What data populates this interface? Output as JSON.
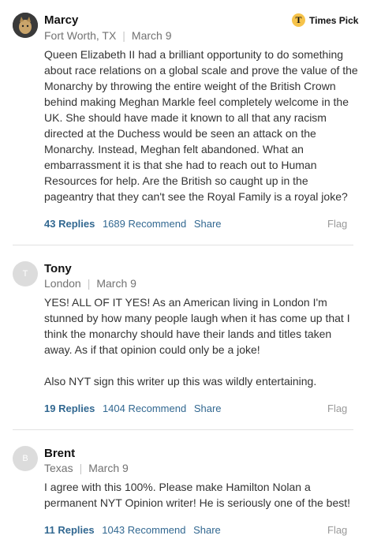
{
  "comments": [
    {
      "name": "Marcy",
      "location": "Fort Worth, TX",
      "date": "March 9",
      "times_pick": "Times Pick",
      "times_pick_badge": "T",
      "body": "Queen Elizabeth II had a brilliant opportunity to do something about race relations on a global scale and prove the value of the Monarchy by throwing the entire weight of the British Crown behind making Meghan Markle feel completely welcome in the UK.  She should have made it known to all that any racism directed at the Duchess would be seen an attack on the Monarchy.  Instead, Meghan felt abandoned.  What an embarrassment it is that she had to reach out to Human Resources for help.  Are the British so caught up in the pageantry that they can't see the Royal Family is a royal joke?",
      "replies": "43 Replies",
      "recommend": "1689 Recommend",
      "share": "Share",
      "flag": "Flag"
    },
    {
      "name": "Tony",
      "initial": "T",
      "location": "London",
      "date": "March 9",
      "body": "YES! ALL OF IT YES! As an American living in London I'm stunned by how many people laugh when it has come up that I think the monarchy should have their lands and titles taken away. As if that opinion could only be a joke!\n\nAlso NYT sign this writer up this was wildly entertaining.",
      "replies": "19 Replies",
      "recommend": "1404 Recommend",
      "share": "Share",
      "flag": "Flag"
    },
    {
      "name": "Brent",
      "initial": "B",
      "location": "Texas",
      "date": "March 9",
      "body": "I agree with this 100%. Please make Hamilton Nolan a permanent NYT Opinion writer! He is seriously one of the best!",
      "replies": "11 Replies",
      "recommend": "1043 Recommend",
      "share": "Share",
      "flag": "Flag"
    }
  ]
}
